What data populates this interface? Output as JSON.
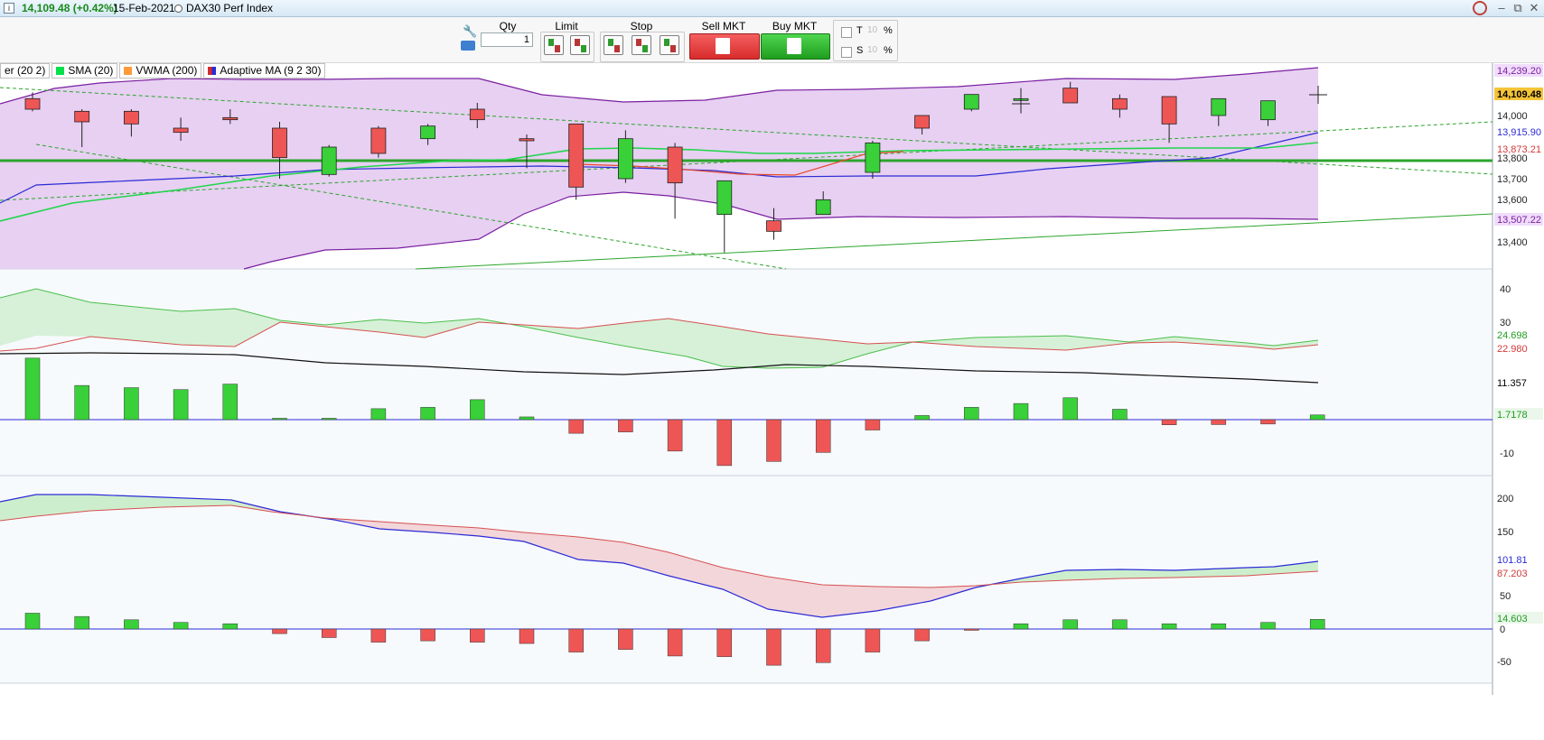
{
  "titlebar": {
    "info_icon": "i",
    "last_price": "14,109.48 (+0.42%)",
    "date": "15-Feb-2021",
    "instrument": "DAX30 Perf Index",
    "win_controls": [
      "–",
      "⧉",
      "✕"
    ]
  },
  "toolbar": {
    "qty_label": "Qty",
    "qty_value": "1",
    "limit_label": "Limit",
    "stop_label": "Stop",
    "sell_label": "Sell MKT",
    "buy_label": "Buy MKT",
    "t_label": "T",
    "s_label": "S",
    "t_value": "10",
    "s_value": "10",
    "pct": "%"
  },
  "legend": [
    {
      "label": "er (20 2)",
      "color": ""
    },
    {
      "label": "SMA (20)",
      "color": "#00e04a"
    },
    {
      "label": "VWMA (200)",
      "color": "#ff9a3a"
    },
    {
      "label": "Adaptive MA (9 2 30)",
      "color": "#2b2bd6"
    }
  ],
  "price_axis": {
    "ticks": [
      "13,400",
      "13,600",
      "13,700",
      "13,800",
      "14,000"
    ],
    "badges": [
      {
        "text": "14,239.20",
        "color": "#7a1fa0",
        "bg": "#f0dcfb"
      },
      {
        "text": "14,109.48",
        "color": "#000000",
        "bg": "#f5c438"
      },
      {
        "text": "13,915.90",
        "color": "#2b2bd6",
        "bg": "#ffffff"
      },
      {
        "text": "13,873.21",
        "color": "#d23a3a",
        "bg": "#ffffff"
      },
      {
        "text": "13,507.22",
        "color": "#7a1fa0",
        "bg": "#f0dcfb"
      }
    ]
  },
  "ind1_axis": {
    "ticks": [
      "40",
      "30",
      "-10"
    ],
    "badges": [
      {
        "text": "24.698",
        "color": "#1f9d1f"
      },
      {
        "text": "22.980",
        "color": "#d23a3a"
      },
      {
        "text": "11.357",
        "color": "#000000"
      },
      {
        "text": "1.7178",
        "color": "#1f9d1f"
      }
    ]
  },
  "ind2_axis": {
    "ticks": [
      "200",
      "150",
      "50",
      "0",
      "-50"
    ],
    "badges": [
      {
        "text": "101.81",
        "color": "#2b2bd6"
      },
      {
        "text": "87.203",
        "color": "#d23a3a"
      },
      {
        "text": "14.603",
        "color": "#1f9d1f"
      }
    ]
  },
  "chart_data": [
    {
      "type": "candlestick",
      "series_name": "DAX30 Perf Index",
      "candles": [
        {
          "o": 14080,
          "h": 14110,
          "l": 14020,
          "c": 14030
        },
        {
          "o": 14020,
          "h": 14030,
          "l": 13850,
          "c": 13970
        },
        {
          "o": 14020,
          "h": 14030,
          "l": 13900,
          "c": 13960
        },
        {
          "o": 13940,
          "h": 13990,
          "l": 13880,
          "c": 13920
        },
        {
          "o": 13990,
          "h": 14030,
          "l": 13960,
          "c": 13980
        },
        {
          "o": 13940,
          "h": 13970,
          "l": 13700,
          "c": 13800
        },
        {
          "o": 13720,
          "h": 13860,
          "l": 13710,
          "c": 13850
        },
        {
          "o": 13940,
          "h": 13950,
          "l": 13800,
          "c": 13820
        },
        {
          "o": 13890,
          "h": 13960,
          "l": 13860,
          "c": 13950
        },
        {
          "o": 14030,
          "h": 14060,
          "l": 13940,
          "c": 13980
        },
        {
          "o": 13890,
          "h": 13910,
          "l": 13750,
          "c": 13880
        },
        {
          "o": 13960,
          "h": 13960,
          "l": 13600,
          "c": 13660
        },
        {
          "o": 13700,
          "h": 13930,
          "l": 13680,
          "c": 13890
        },
        {
          "o": 13850,
          "h": 13870,
          "l": 13510,
          "c": 13680
        },
        {
          "o": 13530,
          "h": 13690,
          "l": 13350,
          "c": 13690
        },
        {
          "o": 13500,
          "h": 13560,
          "l": 13410,
          "c": 13450
        },
        {
          "o": 13530,
          "h": 13640,
          "l": 13530,
          "c": 13600
        },
        {
          "o": 13730,
          "h": 13880,
          "l": 13700,
          "c": 13870
        },
        {
          "o": 14000,
          "h": 14000,
          "l": 13910,
          "c": 13940
        },
        {
          "o": 14030,
          "h": 14100,
          "l": 14020,
          "c": 14100
        },
        {
          "o": 14080,
          "h": 14130,
          "l": 14010,
          "c": 14080
        },
        {
          "o": 14130,
          "h": 14160,
          "l": 14060,
          "c": 14060
        },
        {
          "o": 14080,
          "h": 14100,
          "l": 13990,
          "c": 14030
        },
        {
          "o": 14090,
          "h": 14090,
          "l": 13870,
          "c": 13960
        },
        {
          "o": 14000,
          "h": 14060,
          "l": 13950,
          "c": 14080
        },
        {
          "o": 13980,
          "h": 14050,
          "l": 13950,
          "c": 14070
        }
      ],
      "last_marker": 14109.48
    },
    {
      "type": "bar",
      "name": "indicator-1",
      "values": [
        22.5,
        12.5,
        11.7,
        11.0,
        13.0,
        0.5,
        0.5,
        4.0,
        4.5,
        7.3,
        1.0,
        -5.0,
        -4.5,
        -11.5,
        -16.8,
        -15.3,
        -12.0,
        -3.8,
        1.5,
        4.5,
        5.9,
        8.0,
        3.8,
        -1.9,
        -1.8,
        -1.6,
        1.7178
      ],
      "ylim": [
        -15,
        45
      ]
    },
    {
      "type": "bar",
      "name": "indicator-2",
      "values": [
        24,
        19,
        14,
        10,
        8,
        -7,
        -13,
        -20,
        -18,
        -20,
        -22,
        -35,
        -31,
        -41,
        -42,
        -55,
        -51,
        -35,
        -18,
        -2,
        8,
        14,
        14,
        8,
        8,
        10,
        14.603
      ],
      "ylim": [
        -60,
        220
      ]
    }
  ],
  "colors": {
    "up": "#39d039",
    "down": "#ee5656",
    "band": "#e7d0f2",
    "band_edge": "#7a1fa0",
    "sma": "#1fd64a",
    "adaptive": "#2b2bd6",
    "vwma": "#e84a2a",
    "support": "#2ca52c"
  }
}
